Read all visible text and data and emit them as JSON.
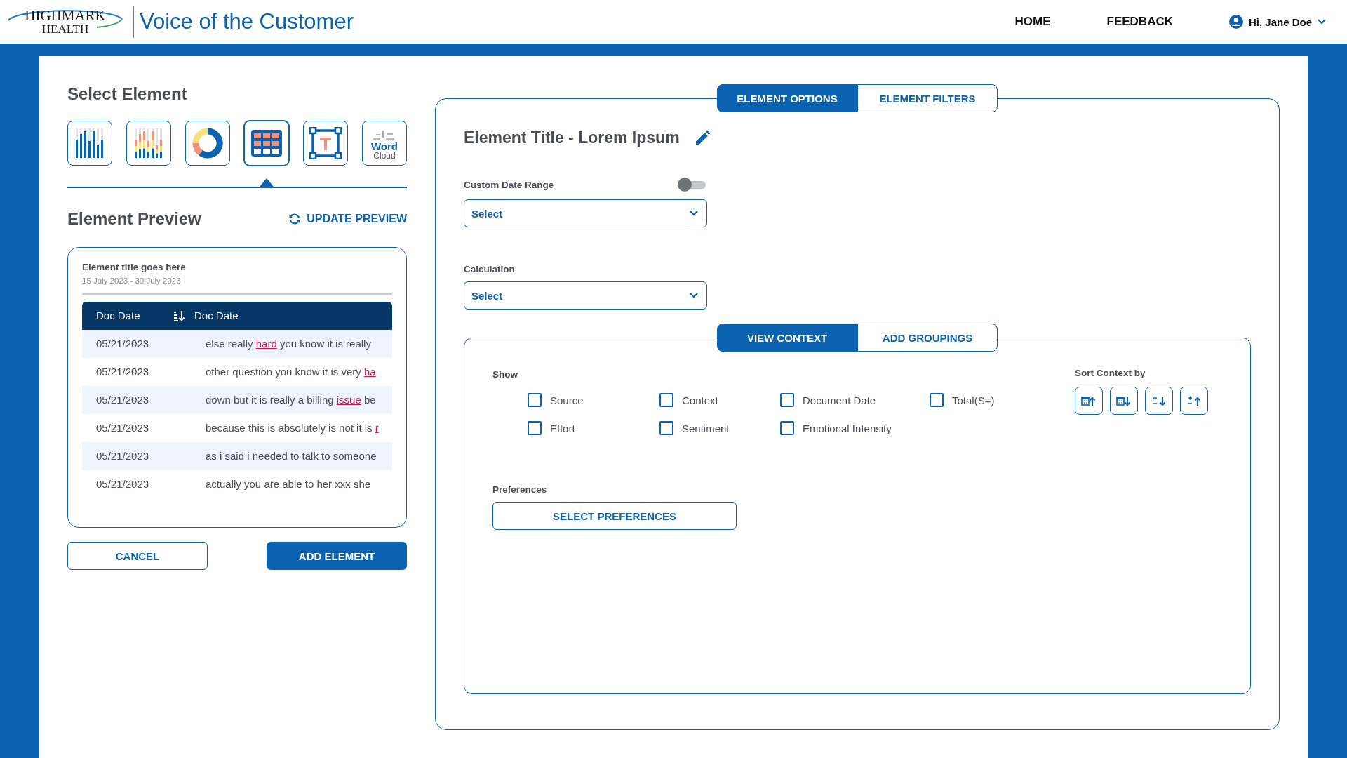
{
  "header": {
    "logo_top": "HIGHMARK",
    "logo_bottom": "HEALTH",
    "app_title": "Voice of the Customer",
    "nav": [
      {
        "label": "HOME"
      },
      {
        "label": "FEEDBACK"
      }
    ],
    "user": "Hi, Jane Doe"
  },
  "select_element": {
    "title": "Select Element",
    "types": [
      {
        "kind": "bar",
        "selected": false
      },
      {
        "kind": "stacked",
        "selected": false
      },
      {
        "kind": "donut",
        "selected": false
      },
      {
        "kind": "table",
        "selected": true
      },
      {
        "kind": "text",
        "selected": false
      },
      {
        "kind": "wordcloud",
        "label": "Word Cloud",
        "selected": false
      }
    ]
  },
  "preview": {
    "title": "Element Preview",
    "update": "UPDATE PREVIEW",
    "card_title": "Element title goes here",
    "date_range": "15 July 2023 - 30 July 2023",
    "columns": [
      "Doc Date",
      "Doc Date"
    ],
    "rows": [
      {
        "date": "05/21/2023",
        "text": [
          {
            "t": "else really ",
            "hl": false
          },
          {
            "t": "hard",
            "hl": true
          },
          {
            "t": " you know it is really",
            "hl": false
          }
        ]
      },
      {
        "date": "05/21/2023",
        "text": [
          {
            "t": "other question you know it is very ",
            "hl": false
          },
          {
            "t": "ha",
            "hl": true
          }
        ]
      },
      {
        "date": "05/21/2023",
        "text": [
          {
            "t": "down but it is really a billing ",
            "hl": false
          },
          {
            "t": "issue",
            "hl": true
          },
          {
            "t": " be",
            "hl": false
          }
        ]
      },
      {
        "date": "05/21/2023",
        "text": [
          {
            "t": "because this is absolutely is not it is ",
            "hl": false
          },
          {
            "t": "r",
            "hl": true
          }
        ]
      },
      {
        "date": "05/21/2023",
        "text": [
          {
            "t": "as i said i needed to talk to someone",
            "hl": false
          }
        ]
      },
      {
        "date": "05/21/2023",
        "text": [
          {
            "t": "actually you are able to her xxx she",
            "hl": false
          }
        ]
      }
    ]
  },
  "actions": {
    "cancel": "CANCEL",
    "add": "ADD ELEMENT"
  },
  "options": {
    "tabs": [
      {
        "label": "ELEMENT OPTIONS",
        "selected": true
      },
      {
        "label": "ELEMENT FILTERS",
        "selected": false
      }
    ],
    "element_title": "Element Title - Lorem Ipsum",
    "custom_date_range": {
      "label": "Custom Date Range",
      "on": false,
      "placeholder": "Select"
    },
    "calculation": {
      "label": "Calculation",
      "placeholder": "Select"
    },
    "context_tabs": [
      {
        "label": "VIEW CONTEXT",
        "selected": true
      },
      {
        "label": "ADD GROUPINGS",
        "selected": false
      }
    ],
    "show_label": "Show",
    "show_options": [
      {
        "label": "Source",
        "checked": false
      },
      {
        "label": "Context",
        "checked": false
      },
      {
        "label": "Document Date",
        "checked": false
      },
      {
        "label": "Total(S=)",
        "checked": false
      },
      {
        "label": "Effort",
        "checked": false
      },
      {
        "label": "Sentiment",
        "checked": false
      },
      {
        "label": "Emotional Intensity",
        "checked": false
      }
    ],
    "sort_label": "Sort Context by",
    "preferences_label": "Preferences",
    "preferences_button": "SELECT PREFERENCES"
  }
}
